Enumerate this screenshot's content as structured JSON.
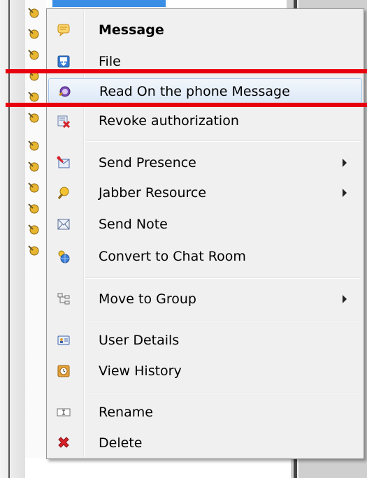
{
  "menu": {
    "items": [
      {
        "label": "Message",
        "icon": "message-icon",
        "bold": true
      },
      {
        "label": "File",
        "icon": "file-transfer-icon"
      },
      {
        "label": "Read On the phone Message",
        "icon": "phone-message-icon",
        "highlighted": true
      },
      {
        "label": "Revoke authorization",
        "icon": "revoke-icon"
      },
      {
        "label": "Send Presence",
        "icon": "send-presence-icon",
        "submenu": true
      },
      {
        "label": "Jabber Resource",
        "icon": "bulb-icon",
        "submenu": true
      },
      {
        "label": "Send Note",
        "icon": "note-envelope-icon"
      },
      {
        "label": "Convert to Chat Room",
        "icon": "chat-room-icon"
      },
      {
        "label": "Move to Group",
        "icon": "group-icon",
        "submenu": true
      },
      {
        "label": "User Details",
        "icon": "user-card-icon"
      },
      {
        "label": "View History",
        "icon": "history-clock-icon"
      },
      {
        "label": "Rename",
        "icon": "rename-icon"
      },
      {
        "label": "Delete",
        "icon": "delete-x-icon"
      }
    ]
  },
  "colors": {
    "menu_bg": "#f0f0f0",
    "highlight_border": "#a8c8ec",
    "annotation_red": "#e8000d",
    "tab_blue": "#3a8ee6"
  }
}
